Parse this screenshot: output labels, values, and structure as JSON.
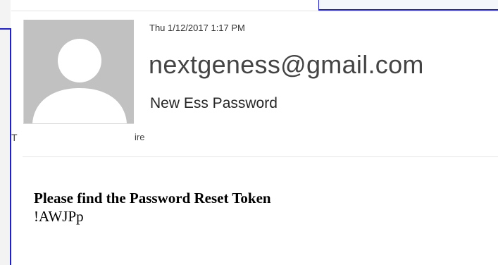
{
  "email": {
    "date": "Thu 1/12/2017 1:17 PM",
    "sender": "nextgeness@gmail.com",
    "subject": "New Ess Password",
    "recipient_prefix_visible": "T",
    "recipient_suffix_visible": "ire"
  },
  "body": {
    "heading": "Please find the Password Reset Token",
    "token": "!AWJPp"
  },
  "icons": {
    "avatar": "person-placeholder-icon"
  },
  "colors": {
    "window_border": "#1f1fd6",
    "avatar_background": "#c1c1c1",
    "avatar_figure": "#ffffff"
  }
}
